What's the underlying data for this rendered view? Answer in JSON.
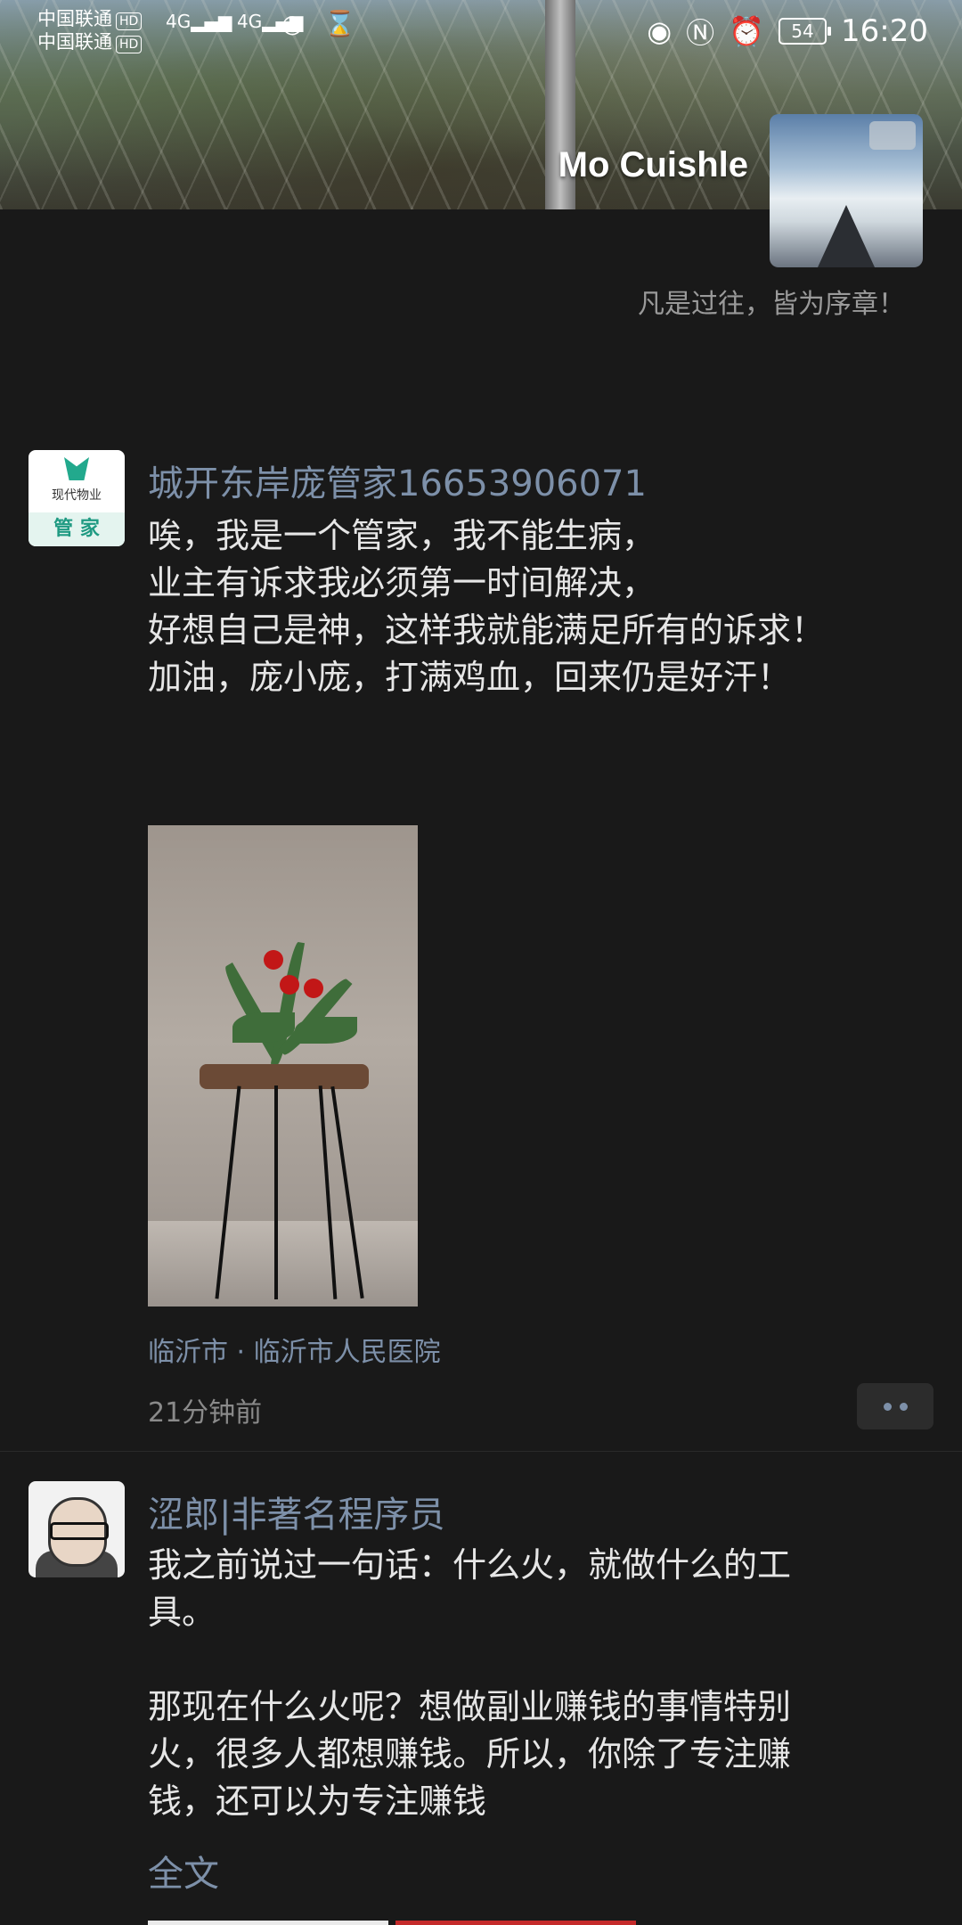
{
  "status_bar": {
    "carrier1": "中国联通",
    "carrier2": "中国联通",
    "hd": "HD",
    "net1": "4G",
    "net2": "4G",
    "battery": "54",
    "time": "16:20"
  },
  "profile": {
    "name": "Mo Cuishle",
    "signature": "凡是过往，皆为序章！"
  },
  "posts": [
    {
      "author": "城开东岸庞管家16653906071",
      "avatar_text": "现代物业",
      "avatar_band": "管 家",
      "text": "唉，我是一个管家，我不能生病，\n业主有诉求我必须第一时间解决，\n好想自己是神，这样我就能满足所有的诉求！\n加油，庞小庞，打满鸡血，回来仍是好汗！",
      "location": "临沂市 · 临沂市人民医院",
      "time": "21分钟前"
    },
    {
      "author": "涩郎|非著名程序员",
      "text": "我之前说过一句话：什么火，就做什么的工具。\n\n那现在什么火呢？想做副业赚钱的事情特别火，很多人都想赚钱。所以，你除了专注赚钱，还可以为专注赚钱",
      "full_text_link": "全文"
    }
  ],
  "colors": {
    "background": "#191919",
    "link": "#7d90a9",
    "text": "#e6e6e6"
  }
}
